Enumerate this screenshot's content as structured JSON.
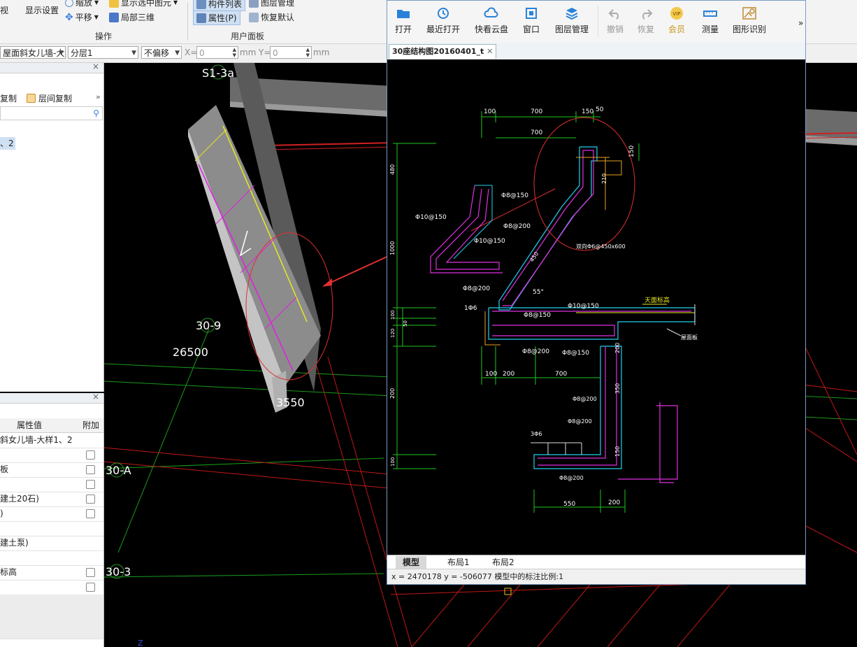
{
  "ribbon": {
    "view_label": "视",
    "display_settings": "显示设置",
    "zoom": "缩放",
    "pan": "平移",
    "show_selected": "显示选中图元",
    "local_3d": "局部三维",
    "group_ops": "操作",
    "component_list": "构件列表",
    "layer_mgmt": "图层管理",
    "properties": "属性(P)",
    "restore_default": "恢复默认",
    "group_user_panel": "用户面板"
  },
  "toolbar": {
    "component_combo": "屋面斜女儿墙-大",
    "layer_combo": "分层1",
    "offset_combo": "不偏移",
    "x_label": "X=",
    "x_value": "0",
    "unit1": "mm",
    "y_label": "Y=",
    "y_value": "0",
    "unit2": "mm"
  },
  "left_top": {
    "copy": "复制",
    "floor_copy": "层间复制",
    "item_suffix": "、2"
  },
  "properties_panel": {
    "header_value": "属性值",
    "header_extra": "附加",
    "rows": [
      {
        "value": "斜女儿墙-大样1、2",
        "check": false
      },
      {
        "value": "",
        "check": true
      },
      {
        "value": "板",
        "check": true
      },
      {
        "value": "",
        "check": true
      },
      {
        "value": "建土20石)",
        "check": true
      },
      {
        "value": ")",
        "check": true
      },
      {
        "value": "",
        "check": false
      },
      {
        "value": "建土泵)",
        "check": false
      },
      {
        "value": "",
        "check": false
      },
      {
        "value": "标高",
        "check": true
      },
      {
        "value": "",
        "check": true
      },
      {
        "value": "",
        "check": false
      },
      {
        "value": "",
        "check": false
      },
      {
        "value": "",
        "check": false
      }
    ]
  },
  "cad_labels": {
    "axis_s13a": "S1-3a",
    "axis_30_9": "30-9",
    "dim_26500": "26500",
    "dim_3550": "3550",
    "axis_30a": "30-A",
    "axis_30_3": "30-3",
    "corner_z": "Z"
  },
  "dwg_window": {
    "buttons": [
      "打开",
      "最近打开",
      "快看云盘",
      "窗口",
      "图层管理",
      "撤销",
      "恢复",
      "会员",
      "测量",
      "图形识别"
    ],
    "more": "»",
    "doc_tab": "30座结构图20160401_t",
    "layout_tabs": [
      "模型",
      "布局1",
      "布局2"
    ],
    "status": "x = 2470178  y = -506077  模型中的标注比例:1"
  },
  "drawing": {
    "dims_top": [
      "100",
      "700",
      "150",
      "50"
    ],
    "dim_700b": "700",
    "dim_150": "150",
    "dim_210": "210",
    "dim_450": "450",
    "left_dims": [
      "480",
      "1000",
      "100",
      "50",
      "120",
      "200",
      "100"
    ],
    "rebar_labels": {
      "r1": "Φ8@150",
      "r2": "Φ10@150",
      "r3": "Φ8@200",
      "r4": "Φ10@150",
      "r5": "双向Φ6@450x600",
      "r6": "Φ8@200",
      "r7": "1Φ6",
      "r8": "Φ8@150",
      "r9": "Φ10@150",
      "r10": "Φ8@200",
      "r11": "Φ8@150",
      "r12": "Φ8@200",
      "r13": "Φ8@200",
      "r14": "3Φ6",
      "r15": "Φ8@200",
      "angle": "55°"
    },
    "roof_label": "天面标高",
    "slab_label": "屋面板",
    "bottom_dims": [
      "100",
      "200",
      "700"
    ],
    "dim_200r": "200",
    "dim_350": "350",
    "dim_150b": "150",
    "bottom2": [
      "550",
      "200"
    ]
  }
}
